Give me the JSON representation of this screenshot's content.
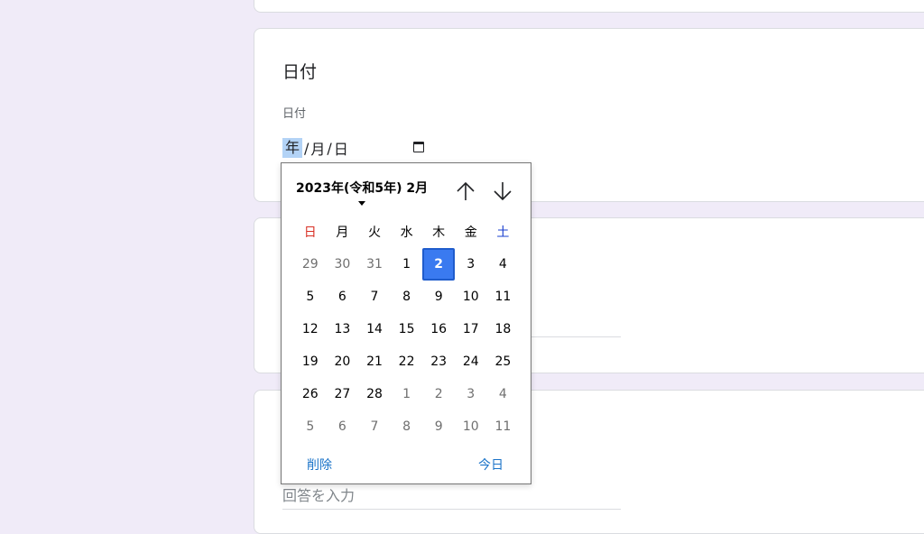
{
  "question": {
    "title": "日付",
    "field_label": "日付",
    "date_input": {
      "year_placeholder": "年",
      "separator": "/",
      "month_placeholder": "月",
      "day_placeholder": "日"
    }
  },
  "answer_placeholder": "回答を入力",
  "picker": {
    "month_title": "2023年(令和5年) 2月",
    "weekdays": [
      "日",
      "月",
      "火",
      "水",
      "木",
      "金",
      "土"
    ],
    "weekday_colors": {
      "sunday": "#d93025",
      "saturday": "#1a3fcf",
      "default": "#000000"
    },
    "weeks": [
      [
        "29",
        "30",
        "31",
        "1",
        "2",
        "3",
        "4"
      ],
      [
        "5",
        "6",
        "7",
        "8",
        "9",
        "10",
        "11"
      ],
      [
        "12",
        "13",
        "14",
        "15",
        "16",
        "17",
        "18"
      ],
      [
        "19",
        "20",
        "21",
        "22",
        "23",
        "24",
        "25"
      ],
      [
        "26",
        "27",
        "28",
        "1",
        "2",
        "3",
        "4"
      ],
      [
        "5",
        "6",
        "7",
        "8",
        "9",
        "10",
        "11"
      ]
    ],
    "other_month_mask": [
      [
        true,
        true,
        true,
        false,
        false,
        false,
        false
      ],
      [
        false,
        false,
        false,
        false,
        false,
        false,
        false
      ],
      [
        false,
        false,
        false,
        false,
        false,
        false,
        false
      ],
      [
        false,
        false,
        false,
        false,
        false,
        false,
        false
      ],
      [
        false,
        false,
        false,
        true,
        true,
        true,
        true
      ],
      [
        true,
        true,
        true,
        true,
        true,
        true,
        true
      ]
    ],
    "selected": {
      "week": 0,
      "day": 4
    },
    "selected_color": "#3a7af0",
    "clear_label": "削除",
    "today_label": "今日",
    "nav_up_icon": "arrow-up-icon",
    "nav_down_icon": "arrow-down-icon"
  }
}
